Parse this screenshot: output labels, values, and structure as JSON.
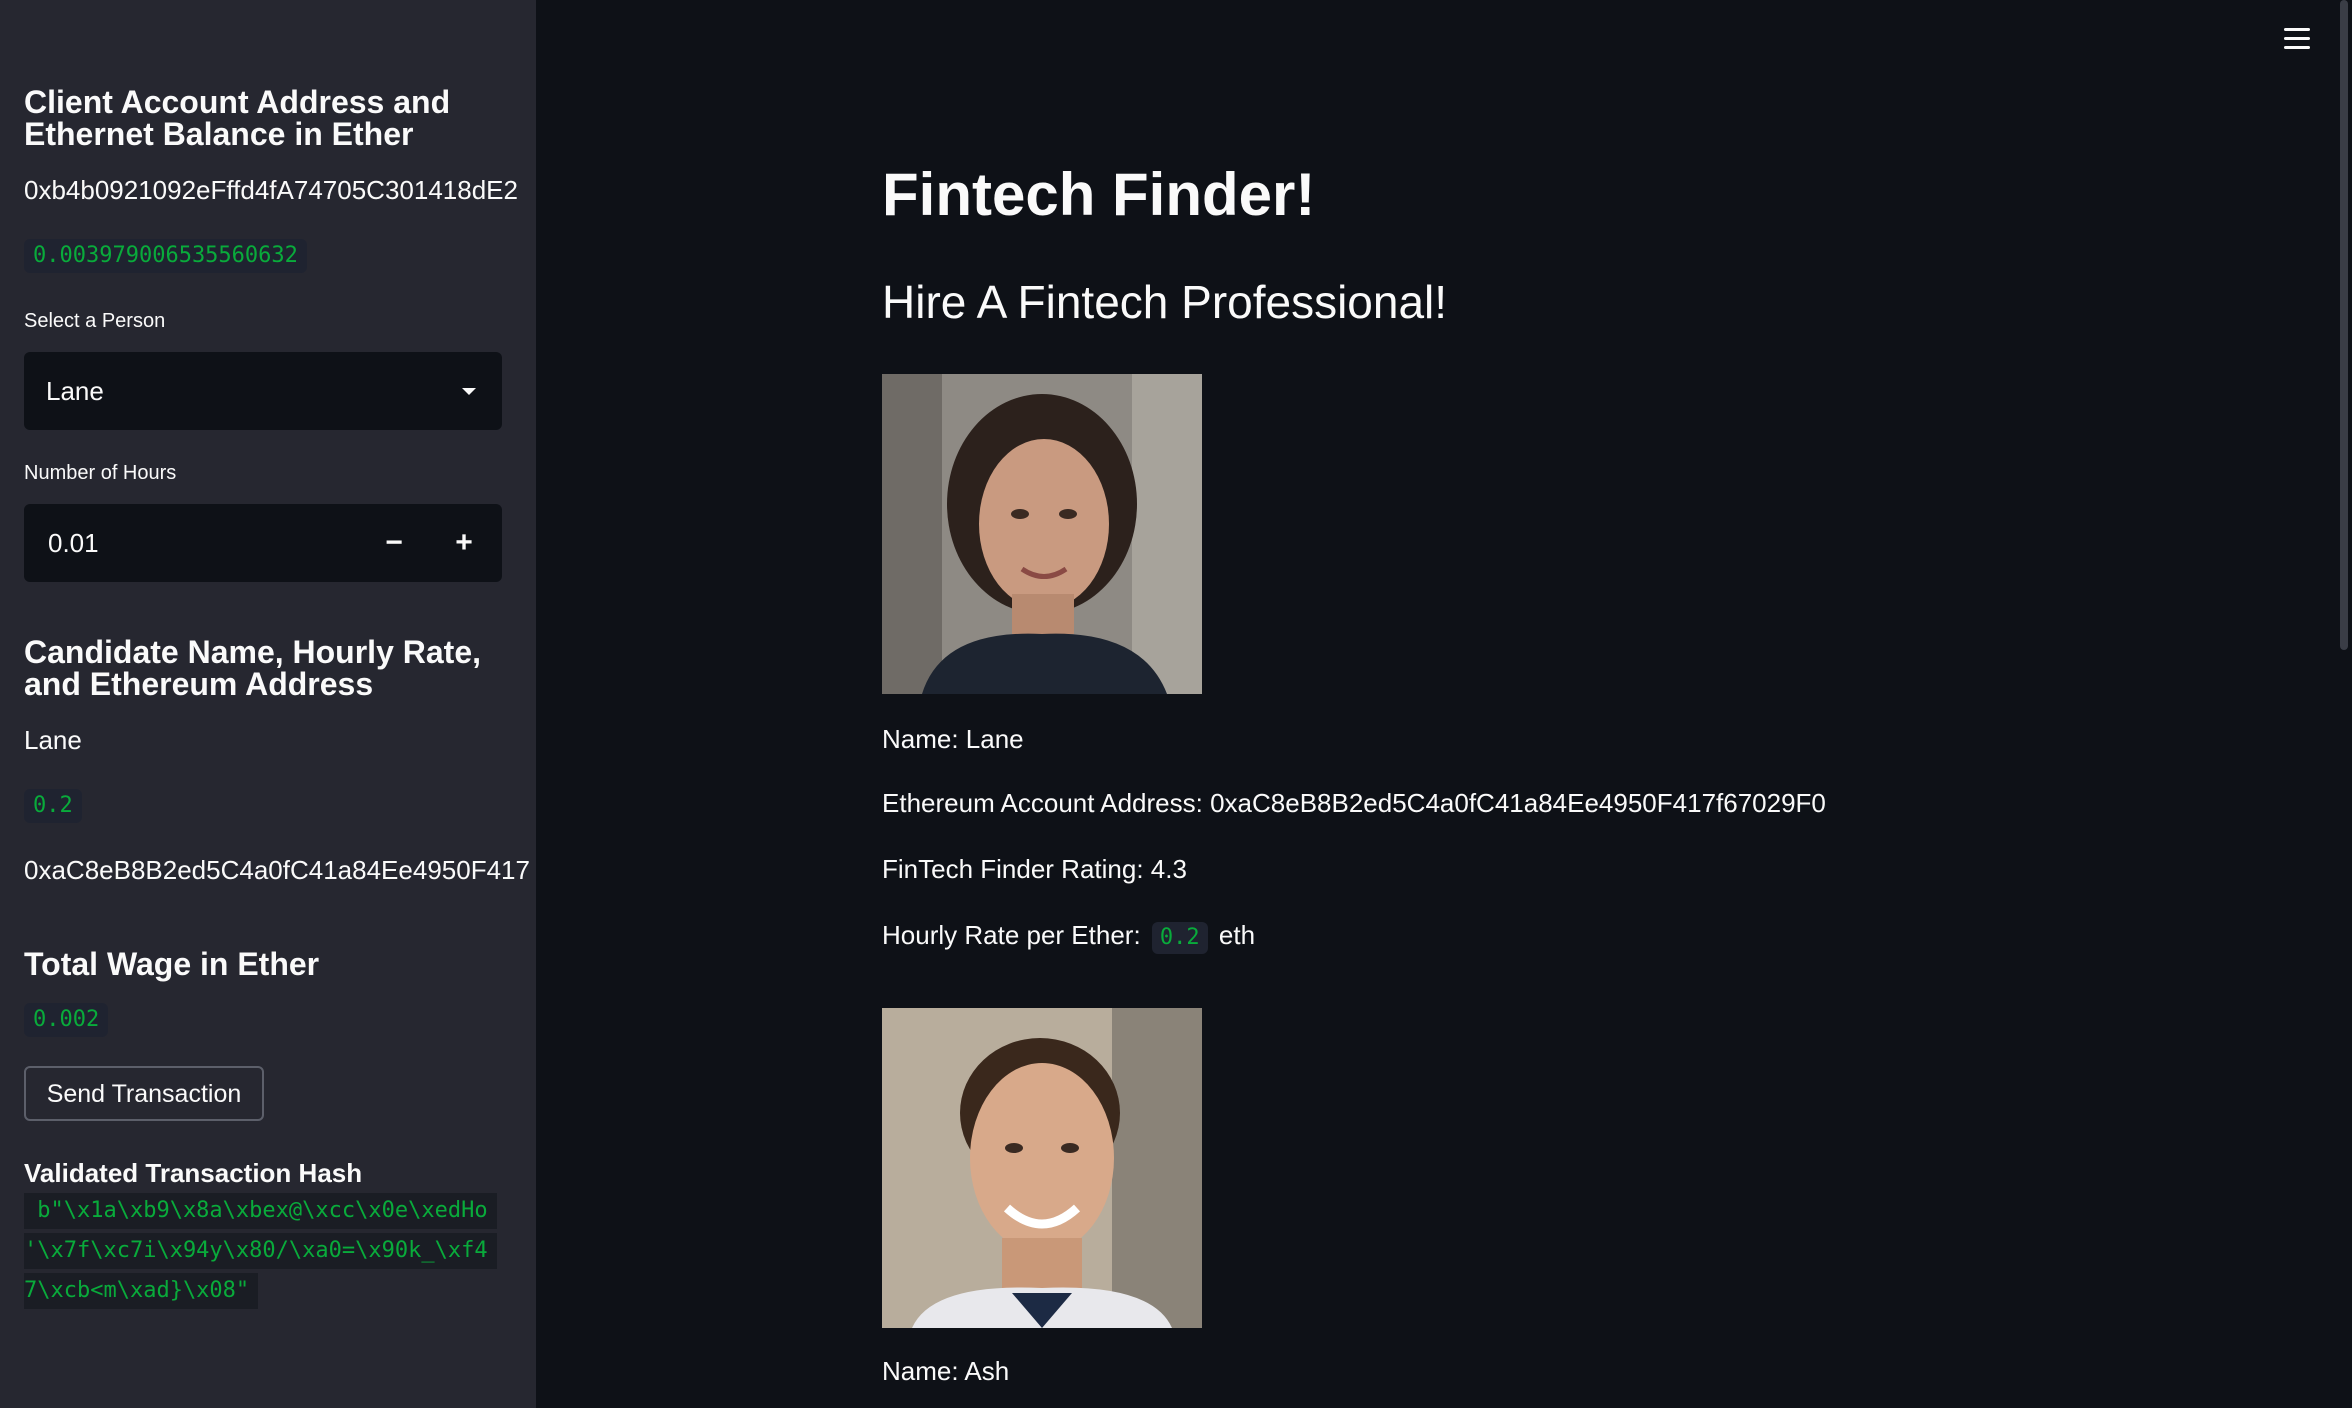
{
  "sidebar": {
    "account_heading": "Client Account Address and Ethernet Balance in Ether",
    "account_address": "0xb4b0921092eFffd4fA74705C301418dE2",
    "balance": "0.003979006535560632",
    "select_label": "Select a Person",
    "select_value": "Lane",
    "hours_label": "Number of Hours",
    "hours_value": "0.01",
    "minus_label": "−",
    "plus_label": "+",
    "candidate_heading": "Candidate Name, Hourly Rate, and Ethereum Address",
    "candidate_name": "Lane",
    "candidate_rate": "0.2",
    "candidate_address": "0xaC8eB8B2ed5C4a0fC41a84Ee4950F417",
    "wage_heading": "Total Wage in Ether",
    "wage_value": "0.002",
    "send_button": "Send Transaction",
    "hash_heading": "Validated Transaction Hash",
    "hash_lines": [
      " b\"\\x1a\\xb9\\x8a\\xbex@\\xcc\\x0e\\xedHo",
      "'\\x7f\\xc7i\\x94y\\x80/\\xa0=\\x90k_\\xf4",
      "7\\xcb<m\\xad}\\x08\""
    ]
  },
  "main": {
    "title": "Fintech Finder!",
    "subtitle": "Hire A Fintech Professional!",
    "candidates": [
      {
        "name": "Name: Lane",
        "address": "Ethereum Account Address: 0xaC8eB8B2ed5C4a0fC41a84Ee4950F417f67029F0",
        "rating": "FinTech Finder Rating: 4.3",
        "rate_prefix": "Hourly Rate per Ether:",
        "rate_value": "0.2",
        "rate_suffix": "eth"
      },
      {
        "name": "Name: Ash"
      }
    ]
  },
  "colors": {
    "sidebar_bg": "#262730",
    "main_bg": "#0e1117",
    "code_green": "#09ab3b"
  },
  "icons": {
    "menu": "hamburger-menu-icon",
    "select": "chevron-down-icon"
  }
}
